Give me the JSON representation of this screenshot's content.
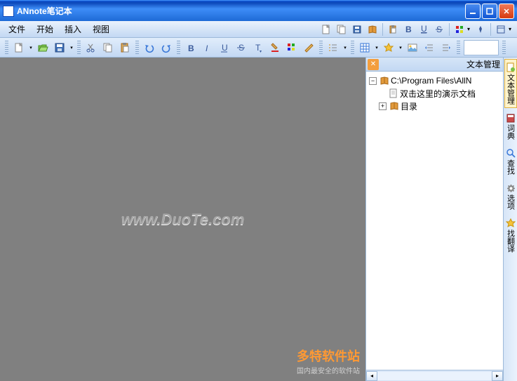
{
  "title": "ANnote笔记本",
  "menu": {
    "file": "文件",
    "start": "开始",
    "insert": "插入",
    "view": "视图"
  },
  "sidepanel": {
    "title": "文本管理",
    "root": "C:\\Program Files\\AllN",
    "demo": "双击这里的演示文档",
    "folder": "目录"
  },
  "vtabs": {
    "t1": "文本管理",
    "t2": "词典",
    "t3": "查找",
    "t4": "选项",
    "t5": "找翻译"
  },
  "watermark": "www.DuoTe.com",
  "promo": {
    "brand": "多特软件站",
    "sub": "国内最安全的软件站"
  }
}
